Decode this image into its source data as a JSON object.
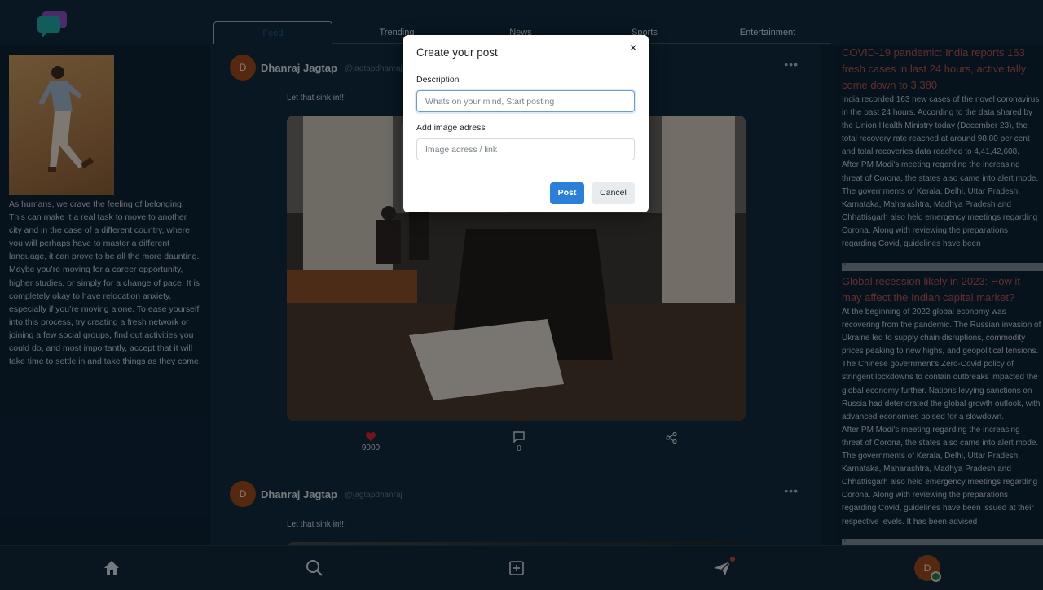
{
  "tabs": [
    {
      "label": "Feed",
      "active": true
    },
    {
      "label": "Trending"
    },
    {
      "label": "News"
    },
    {
      "label": "Sports"
    },
    {
      "label": "Entertainment"
    }
  ],
  "sidebar": {
    "bio": "As humans, we crave the feeling of belonging. This can make it a real task to move to another city and in the case of a different country, where you will perhaps have to master a different language, it can prove to be all the more daunting. Maybe you’re moving for a career opportunity, higher studies, or simply for a change of pace. It is completely okay to have relocation anxiety, especially if you’re moving alone. To ease yourself into this process, try creating a fresh network or joining a few social groups, find out activities you could do, and most importantly, accept that it will take time to settle in and take things as they come."
  },
  "posts": [
    {
      "avatar_letter": "D",
      "author": "Dhanraj Jagtap",
      "handle": "@jagtapdhanraj",
      "text": "Let that sink in!!!",
      "likes": "9000",
      "comments": "0"
    },
    {
      "avatar_letter": "D",
      "author": "Dhanraj Jagtap",
      "handle": "@jagtapdhanraj",
      "text": "Let that sink in!!!"
    }
  ],
  "news": [
    {
      "title": "COVID-19 pandemic: India reports 163 fresh cases in last 24 hours, active tally come down to 3,380",
      "body": "India recorded 163 new cases of the novel coronavirus in the past 24 hours. According to the data shared by the Union Health Ministry today (December 23), the total recovery rate reached at around 98.80 per cent and total recoveries data reached to 4,41,42,608.\nAfter PM Modi's meeting regarding the increasing threat of Corona, the states also came into alert mode. The governments of Kerala, Delhi, Uttar Pradesh, Karnataka, Maharashtra, Madhya Pradesh and Chhattisgarh also held emergency meetings regarding Corona. Along with reviewing the preparations regarding Covid, guidelines have been"
    },
    {
      "title": "Global recession likely in 2023: How it may affect the Indian capital market?",
      "body": "At the beginning of 2022 global economy was recovering from the pandemic. The Russian invasion of Ukraine led to supply chain disruptions, commodity prices peaking to new highs, and geopolitical tensions. The Chinese government's Zero-Covid policy of stringent lockdowns to contain outbreaks impacted the global economy further. Nations levying sanctions on Russia had deteriorated the global growth outlook, with advanced economies poised for a slowdown.\nAfter PM Modi's meeting regarding the increasing threat of Corona, the states also came into alert mode. The governments of Kerala, Delhi, Uttar Pradesh, Karnataka, Maharashtra, Madhya Pradesh and Chhattisgarh also held emergency meetings regarding Corona. Along with reviewing the preparations regarding Covid, guidelines have been issued at their respective levels. It has been advised"
    }
  ],
  "bottom_nav": {
    "home_icon": "home-icon",
    "search_icon": "search-icon",
    "create_icon": "plus-square-icon",
    "send_icon": "send-icon",
    "profile_letter": "D"
  },
  "modal": {
    "title": "Create your post",
    "close": "×",
    "description_label": "Description",
    "description_placeholder": "Whats on your mind, Start posting",
    "image_label": "Add image adress",
    "image_placeholder": "Image adress / link",
    "post_button": "Post",
    "cancel_button": "Cancel"
  },
  "colors": {
    "accent": "#2b7fd8",
    "like": "#d0262f",
    "news_title": "#b7564d",
    "avatar": "#9b4a1d"
  }
}
